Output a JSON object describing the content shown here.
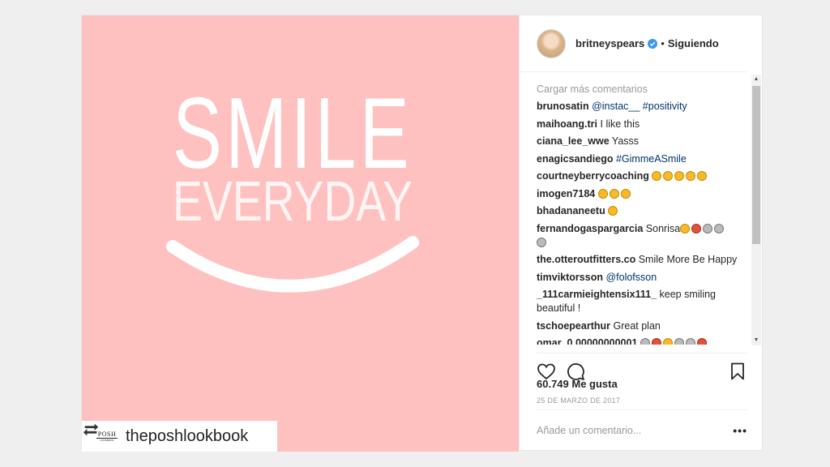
{
  "post": {
    "image_text_line1": "SMILE",
    "image_text_line2": "EVERYDAY",
    "repost_handle": "theposhlookbook",
    "repost_logo_top": "POSH",
    "repost_logo_bottom": "LOOKBOOK",
    "background_color": "#ffc0c0"
  },
  "header": {
    "username": "britneyspears",
    "separator": "•",
    "follow_status": "Siguiendo"
  },
  "comments": {
    "load_more": "Cargar más comentarios",
    "items": [
      {
        "user": "brunosatin",
        "text": "",
        "tags": "@instac__ #positivity"
      },
      {
        "user": "maihoang.tri",
        "text": "I like this",
        "tags": ""
      },
      {
        "user": "ciana_lee_wwe",
        "text": "Yasss",
        "tags": ""
      },
      {
        "user": "enagicsandiego",
        "text": "",
        "tags": "#GimmeASmile"
      },
      {
        "user": "courtneyberrycoaching",
        "text": "",
        "tags": ""
      },
      {
        "user": "imogen7184",
        "text": "",
        "tags": ""
      },
      {
        "user": "bhadananeetu",
        "text": "",
        "tags": ""
      },
      {
        "user": "fernandogaspargarcia",
        "text": "Sonrisa",
        "tags": ""
      },
      {
        "user": "the.otteroutfitters.co",
        "text": "Smile More Be Happy",
        "tags": ""
      },
      {
        "user": "timviktorsson",
        "text": "",
        "tags": "@folofsson"
      },
      {
        "user": "_111carmieightensix111_",
        "text": "keep smiling beautiful !",
        "tags": ""
      },
      {
        "user": "tschoepearthur",
        "text": "Great plan",
        "tags": ""
      },
      {
        "user": "omar_0.00000000001",
        "text": "",
        "tags": ""
      }
    ]
  },
  "actions": {
    "likes": "60.749 Me gusta",
    "date": "25 DE MARZO DE 2017",
    "add_comment_placeholder": "Añade un comentario...",
    "more": "•••"
  },
  "icons": [
    "heart-icon",
    "comment-icon",
    "bookmark-icon",
    "repost-icon",
    "verified-icon",
    "more-options-icon"
  ]
}
